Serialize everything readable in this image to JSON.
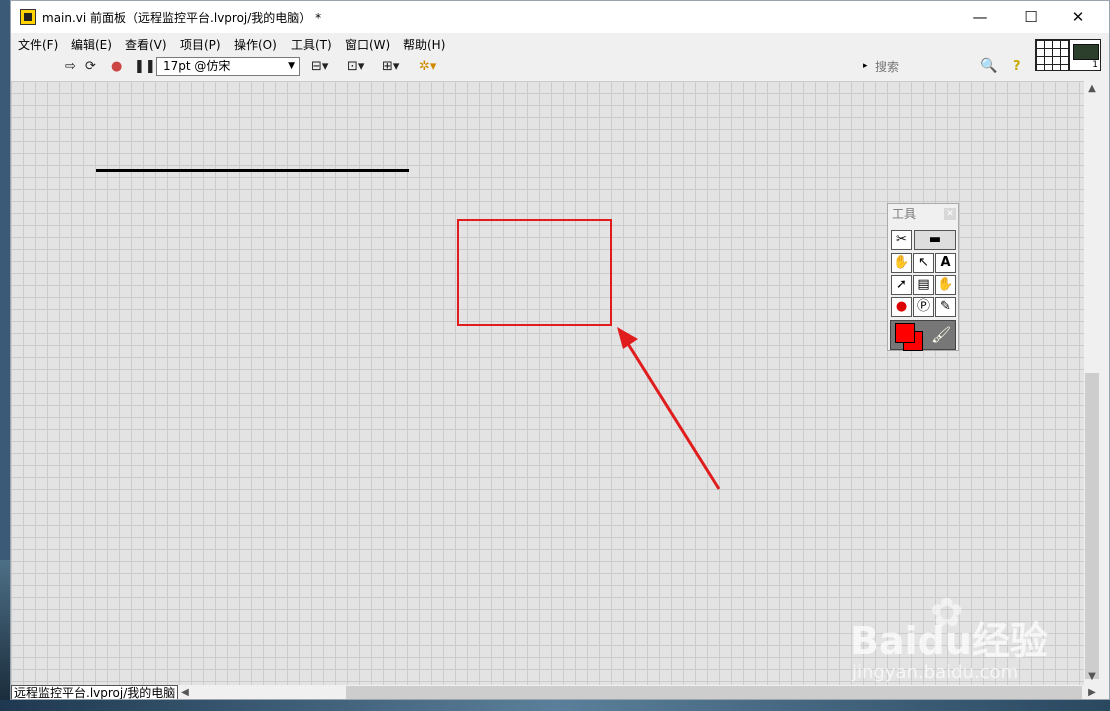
{
  "window": {
    "title": "main.vi 前面板（远程监控平台.lvproj/我的电脑） *",
    "minimize": "—",
    "maximize": "☐",
    "close": "✕"
  },
  "menu": [
    "文件(F)",
    "编辑(E)",
    "查看(V)",
    "项目(P)",
    "操作(O)",
    "工具(T)",
    "窗口(W)",
    "帮助(H)"
  ],
  "toolbar": {
    "font": "17pt @仿宋",
    "search_placeholder": "搜索",
    "help_icon": "?"
  },
  "connector": {
    "number": "1"
  },
  "tools_palette": {
    "title": "工具"
  },
  "colors": {
    "foreground": "#ff0000",
    "background": "#ff0000",
    "annotation": "#e01c1c"
  },
  "statusbar": {
    "context": "远程监控平台.lvproj/我的电脑"
  },
  "watermark": {
    "brand": "Baidu经验",
    "sub": "jingyan.baidu.com"
  }
}
